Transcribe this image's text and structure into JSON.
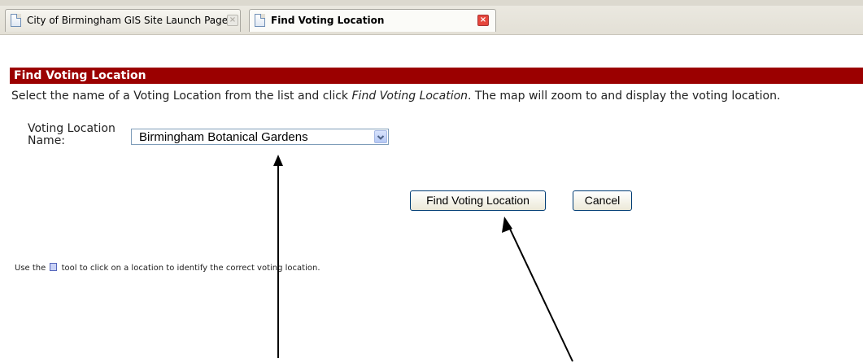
{
  "tabs": [
    {
      "title": "City of Birmingham GIS Site Launch Page",
      "active": false
    },
    {
      "title": "Find Voting Location",
      "active": true
    }
  ],
  "panel": {
    "heading": "Find Voting Location",
    "instructions_before": "Select the name of a Voting Location from the list and click ",
    "instructions_emph": "Find Voting Location",
    "instructions_after": ". The map will zoom to and display the voting location.",
    "field_label_line1": "Voting Location",
    "field_label_line2": "Name:",
    "selected_location": "Birmingham Botanical Gardens",
    "find_button": "Find Voting Location",
    "cancel_button": "Cancel",
    "tip_before": "Use the ",
    "tip_after": " tool to click on a location to identify the correct voting location."
  },
  "icons": {
    "tab_page": "page-icon",
    "tab_close": "close-icon",
    "dropdown": "chevron-down-icon",
    "identify_tool": "identify-tool-icon"
  },
  "colors": {
    "header_bg": "#9b0000",
    "close_active": "#e6463c"
  }
}
